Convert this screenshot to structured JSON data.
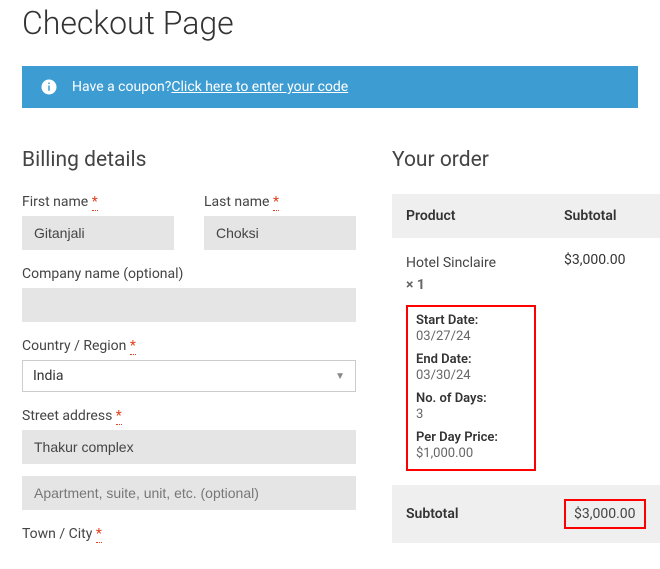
{
  "page": {
    "title": "Checkout Page"
  },
  "coupon": {
    "prompt": "Have a coupon? ",
    "link": "Click here to enter your code"
  },
  "billing": {
    "heading": "Billing details",
    "firstNameLabel": "First name",
    "firstNameValue": "Gitanjali",
    "lastNameLabel": "Last name",
    "lastNameValue": "Choksi",
    "companyLabel": "Company name (optional)",
    "companyValue": "",
    "countryLabel": "Country / Region",
    "countryValue": "India",
    "streetLabel": "Street address",
    "street1Value": "Thakur complex",
    "street2Placeholder": "Apartment, suite, unit, etc. (optional)",
    "street2Value": "",
    "townLabel": "Town / City"
  },
  "order": {
    "heading": "Your order",
    "productHeader": "Product",
    "subtotalHeader": "Subtotal",
    "productName": "Hotel Sinclaire",
    "qtySymbol": "×",
    "qtyValue": "1",
    "lineTotal": "$3,000.00",
    "startDateLabel": "Start Date:",
    "startDateValue": "03/27/24",
    "endDateLabel": "End Date:",
    "endDateValue": "03/30/24",
    "daysLabel": "No. of Days:",
    "daysValue": "3",
    "perDayLabel": "Per Day Price:",
    "perDayValue": "$1,000.00",
    "subtotalLabel": "Subtotal",
    "subtotalValue": "$3,000.00"
  },
  "asterisk": "*"
}
